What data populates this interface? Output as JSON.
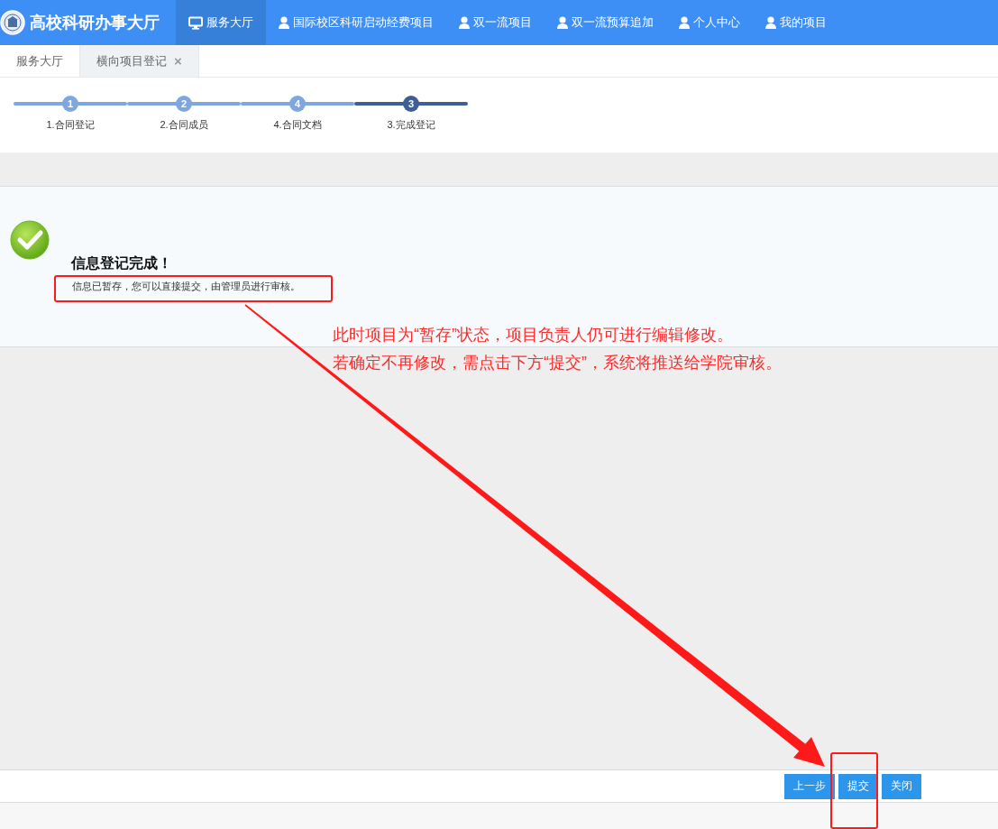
{
  "nav": {
    "title": "高校科研办事大厅",
    "items": [
      {
        "label": "服务大厅",
        "kind": "monitor",
        "selected": true
      },
      {
        "label": "国际校区科研启动经费项目",
        "kind": "person",
        "selected": false
      },
      {
        "label": "双一流项目",
        "kind": "person",
        "selected": false
      },
      {
        "label": "双一流预算追加",
        "kind": "person",
        "selected": false
      },
      {
        "label": "个人中心",
        "kind": "person",
        "selected": false
      },
      {
        "label": "我的项目",
        "kind": "person",
        "selected": false
      }
    ]
  },
  "tabs": [
    {
      "label": "服务大厅",
      "selected": false,
      "closable": false
    },
    {
      "label": "横向项目登记",
      "selected": true,
      "closable": true,
      "close": "×"
    }
  ],
  "steps": [
    {
      "number": "1",
      "label": "1.合同登记",
      "current": false
    },
    {
      "number": "2",
      "label": "2.合同成员",
      "current": false
    },
    {
      "number": "4",
      "label": "4.合同文档",
      "current": false
    },
    {
      "number": "3",
      "label": "3.完成登记",
      "current": true
    }
  ],
  "result": {
    "title": "信息登记完成！",
    "message": "信息已暂存，您可以直接提交，由管理员进行审核。"
  },
  "buttons": [
    {
      "label": "上一步"
    },
    {
      "label": "提交"
    },
    {
      "label": "关闭"
    }
  ],
  "annotation": {
    "lines": [
      "此时项目为“暂存”状态，项目负责人仍可进行编辑修改。",
      "若确定不再修改，需点击下方“提交”，系统将推送给学院审核。"
    ]
  }
}
